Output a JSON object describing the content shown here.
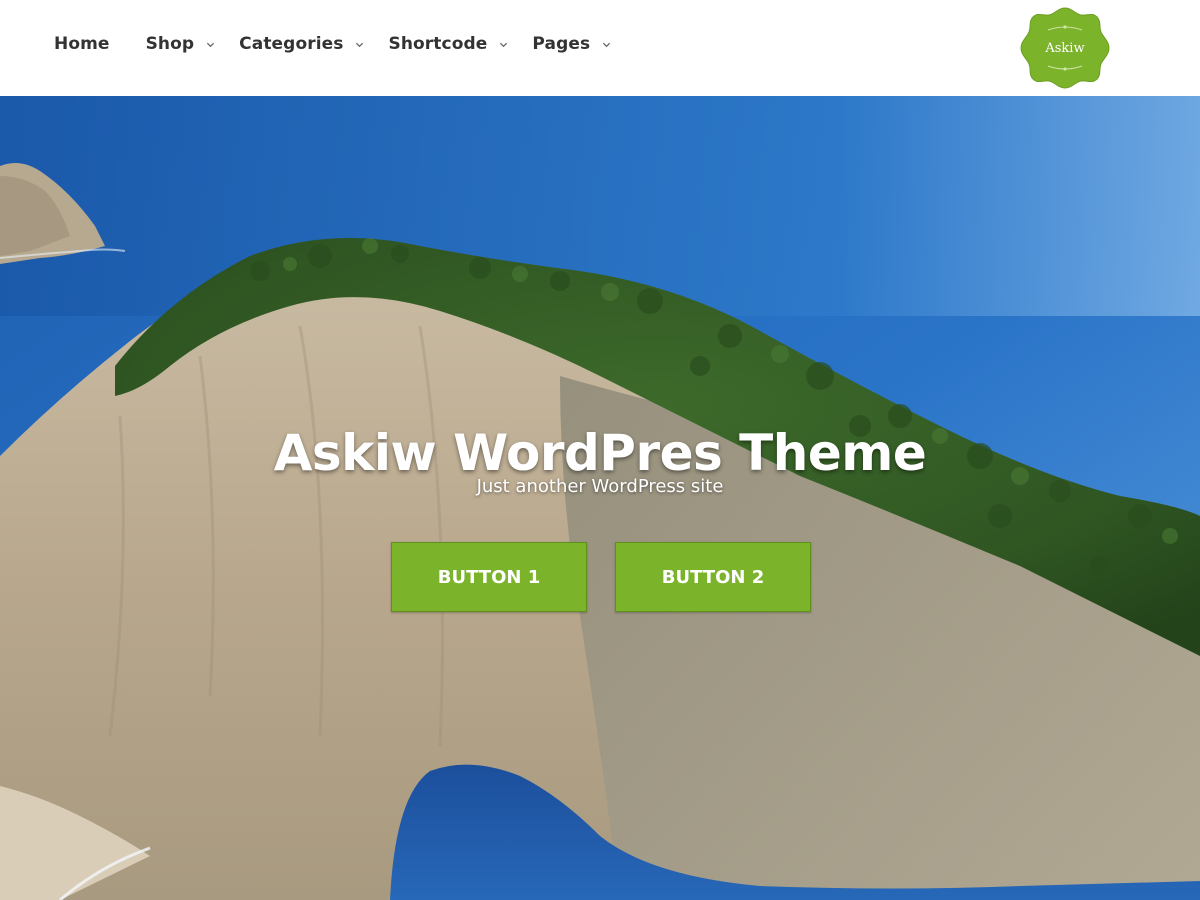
{
  "nav": {
    "items": [
      {
        "label": "Home",
        "has_dropdown": false
      },
      {
        "label": "Shop",
        "has_dropdown": true
      },
      {
        "label": "Categories",
        "has_dropdown": true
      },
      {
        "label": "Shortcode",
        "has_dropdown": true
      },
      {
        "label": "Pages",
        "has_dropdown": true
      }
    ]
  },
  "logo": {
    "text": "Askiw",
    "color": "#7bb32a"
  },
  "hero": {
    "title": "Askiw WordPres Theme",
    "tagline": "Just another WordPress site",
    "button_1": "BUTTON 1",
    "button_2": "BUTTON 2",
    "button_color": "#7bb32a",
    "background_image": "sea-cliff-island-photo"
  },
  "icons": {
    "dropdown": "chevron-down-icon"
  }
}
